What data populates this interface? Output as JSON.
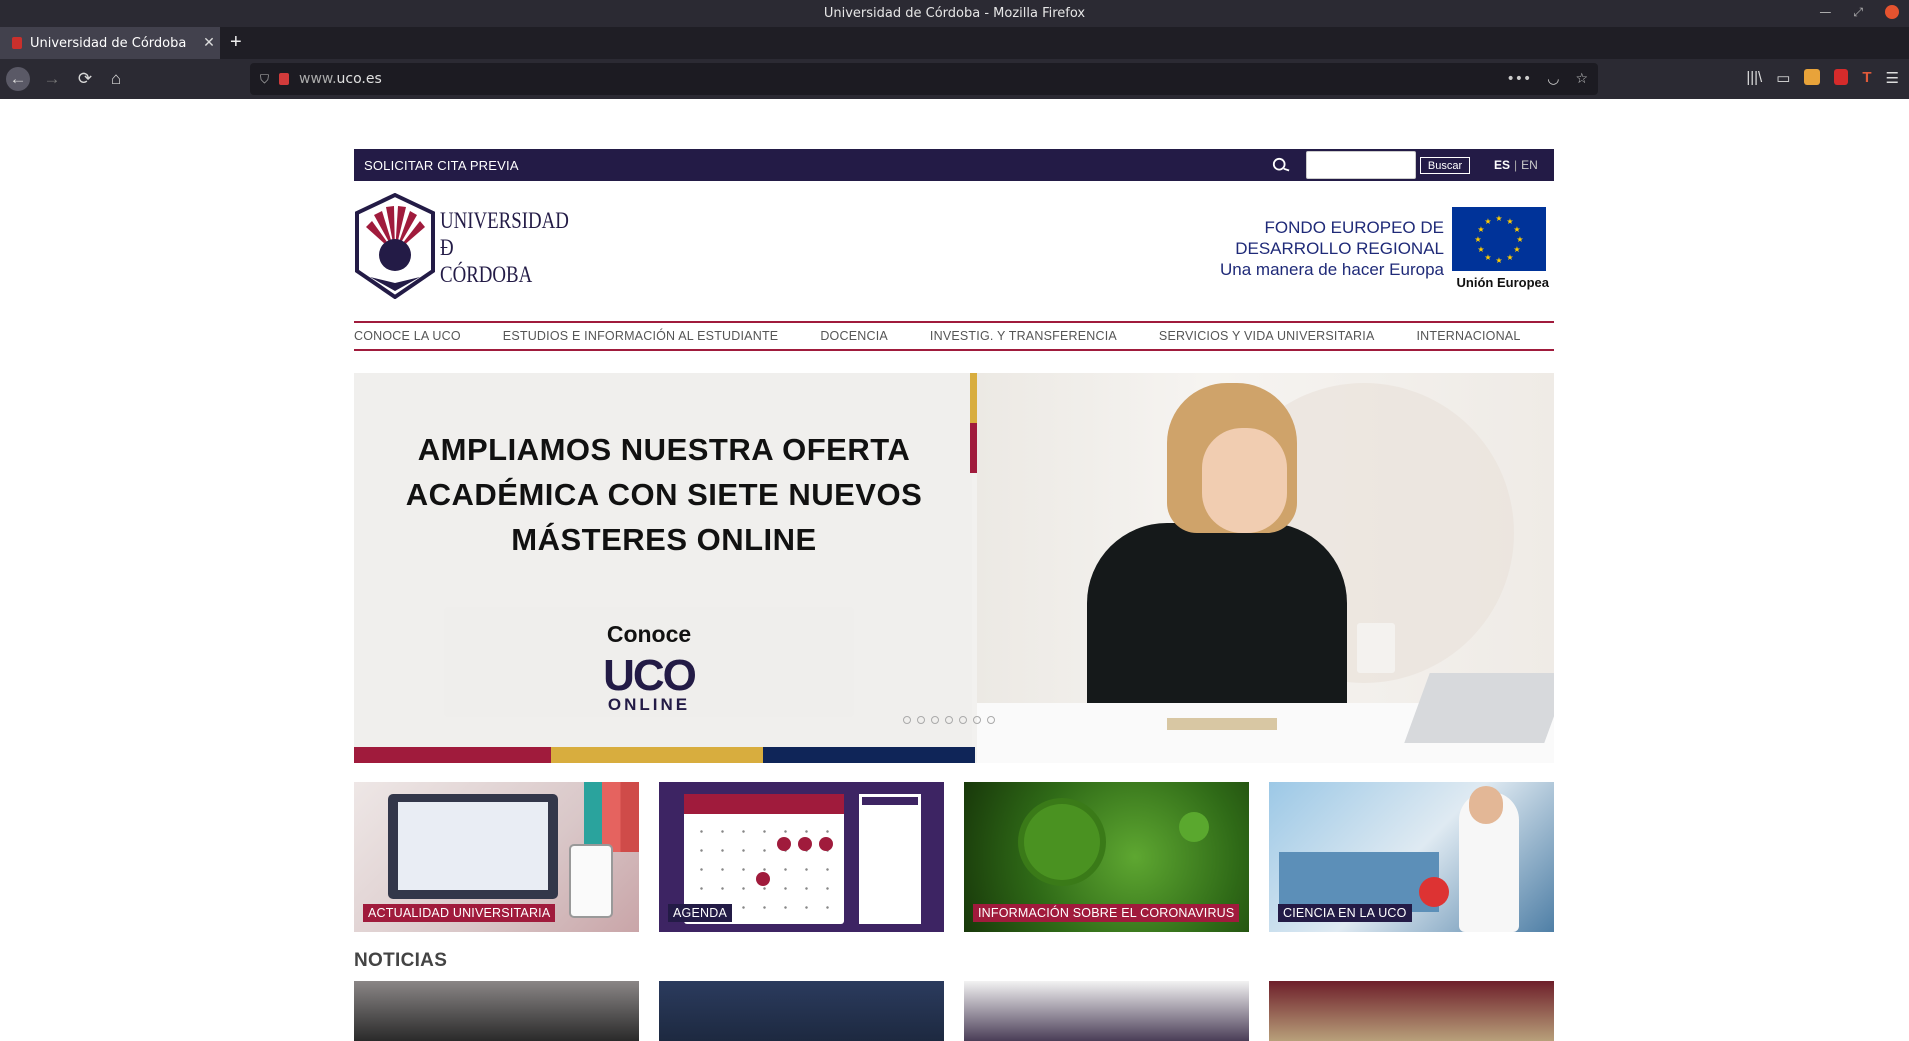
{
  "window": {
    "title": "Universidad de Córdoba - Mozilla Firefox"
  },
  "browser": {
    "tab_title": "Universidad de Córdoba",
    "url_prefix": "www.",
    "url_domain": "uco.es"
  },
  "topbar": {
    "cita": "SOLICITAR CITA PREVIA",
    "search_button": "Buscar",
    "lang_es": "ES",
    "lang_en": "EN"
  },
  "header": {
    "logo_line1": "UNIVERSIDAD",
    "logo_line2": "Ð",
    "logo_line3": "CÓRDOBA",
    "feder_line1": "FONDO EUROPEO DE",
    "feder_line2": "DESARROLLO REGIONAL",
    "feder_line3": "Una manera de hacer Europa",
    "eu_label": "Unión Europea"
  },
  "nav": {
    "items": [
      "CONOCE LA UCO",
      "ESTUDIOS E INFORMACIÓN AL ESTUDIANTE",
      "DOCENCIA",
      "INVESTIG. Y TRANSFERENCIA",
      "SERVICIOS Y VIDA UNIVERSITARIA",
      "INTERNACIONAL"
    ]
  },
  "hero": {
    "line1": "AMPLIAMOS NUESTRA OFERTA",
    "line2": "ACADÉMICA CON SIETE NUEVOS",
    "line3": "MÁSTERES ONLINE",
    "promo_conoce": "Conoce",
    "promo_uco": "UCO",
    "promo_online": "ONLINE",
    "slide_count": 7,
    "colors": {
      "red": "#a01b3c",
      "gold": "#d8ad3e",
      "navy": "#0f2558"
    }
  },
  "cards": [
    "ACTUALIDAD UNIVERSITARIA",
    "AGENDA",
    "INFORMACIÓN SOBRE EL CORONAVIRUS",
    "CIENCIA EN LA UCO"
  ],
  "news": {
    "heading": "NOTICIAS"
  }
}
